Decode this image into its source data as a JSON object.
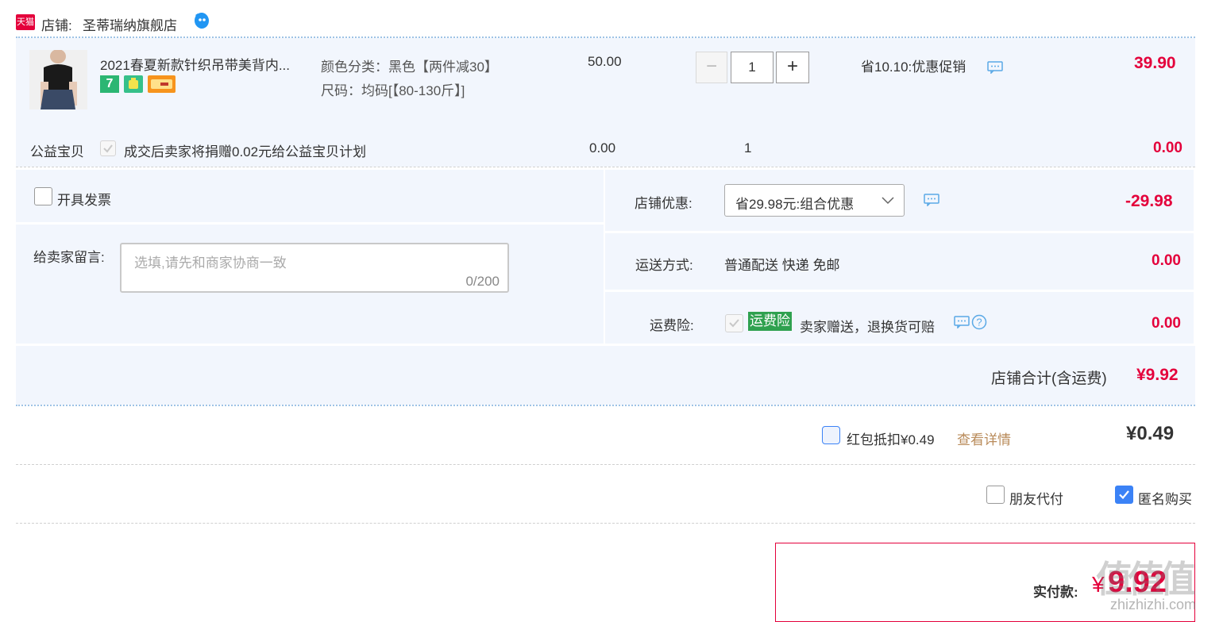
{
  "shop": {
    "logo_text": "天猫",
    "label": "店铺:",
    "name": "圣蒂瑞纳旗舰店"
  },
  "item": {
    "title": "2021春夏新款针织吊带美背内...",
    "spec_color": "颜色分类：黑色【两件减30】",
    "spec_size": "尺码：均码[【80-130斤】]",
    "price": "50.00",
    "quantity": "1",
    "promo": "省10.10:优惠促销",
    "subtotal": "39.90",
    "badge_7": "7"
  },
  "charity": {
    "label": "公益宝贝",
    "text": "成交后卖家将捐赠0.02元给公益宝贝计划",
    "price": "0.00",
    "quantity": "1",
    "subtotal": "0.00"
  },
  "invoice": {
    "label": "开具发票"
  },
  "message": {
    "label": "给卖家留言:",
    "placeholder": "选填,请先和商家协商一致",
    "counter": "0/200"
  },
  "shop_discount": {
    "label": "店铺优惠:",
    "selected": "省29.98元:组合优惠",
    "amount": "-29.98"
  },
  "shipping": {
    "label": "运送方式:",
    "value": "普通配送 快递 免邮",
    "amount": "0.00"
  },
  "insurance": {
    "label": "运费险:",
    "tag": "运费险",
    "text": "卖家赠送，退换货可赔",
    "amount": "0.00"
  },
  "shop_total": {
    "label": "店铺合计(含运费)",
    "amount": "¥9.92"
  },
  "redpacket": {
    "label": "红包抵扣¥0.49",
    "detail_link": "查看详情",
    "amount": "¥0.49"
  },
  "options": {
    "friend_pay": "朋友代付",
    "anonymous": "匿名购买"
  },
  "payment": {
    "label": "实付款:",
    "currency": "¥",
    "amount": "9.92"
  },
  "watermark": {
    "top": "值值值",
    "site": "zhizhizhi.com"
  },
  "colors": {
    "accent_red": "#e4003b",
    "link_blue": "#3b82f6",
    "panel_bg": "#f2f6fd",
    "green_tag": "#2fa14f"
  }
}
